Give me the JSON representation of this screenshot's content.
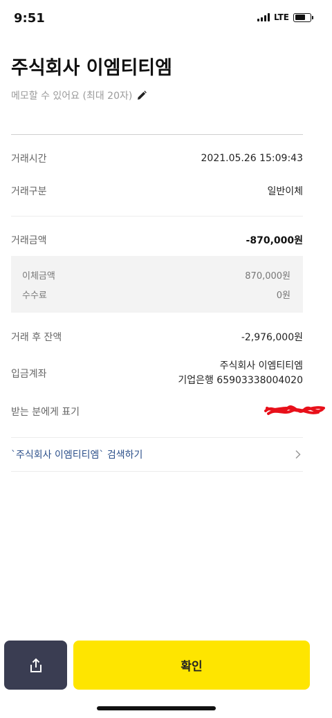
{
  "status_bar": {
    "time": "9:51",
    "network": "LTE"
  },
  "header": {
    "title": "주식회사 이엠티티엠",
    "memo_placeholder": "메모할 수 있어요 (최대 20자)"
  },
  "details": {
    "time_label": "거래시간",
    "time_value": "2021.05.26 15:09:43",
    "type_label": "거래구분",
    "type_value": "일반이체",
    "amount_label": "거래금액",
    "amount_value": "-870,000원",
    "transfer_label": "이체금액",
    "transfer_value": "870,000원",
    "fee_label": "수수료",
    "fee_value": "0원",
    "balance_label": "거래 후 잔액",
    "balance_value": "-2,976,000원",
    "account_label": "입금계좌",
    "account_name": "주식회사 이엠티티엠",
    "account_number": "기업은행 65903338004020",
    "display_label": "받는 분에게 표기"
  },
  "search_link": {
    "label": "`주식회사 이엠티티엠` 검색하기"
  },
  "buttons": {
    "confirm": "확인"
  },
  "icons": {
    "memo": "pencil-icon",
    "share": "share-icon",
    "chevron": "chevron-right-icon"
  },
  "colors": {
    "confirm_bg": "#fee500",
    "share_bg": "#3a3d52",
    "link_text": "#2b4f8a",
    "redaction": "#e8101a"
  }
}
